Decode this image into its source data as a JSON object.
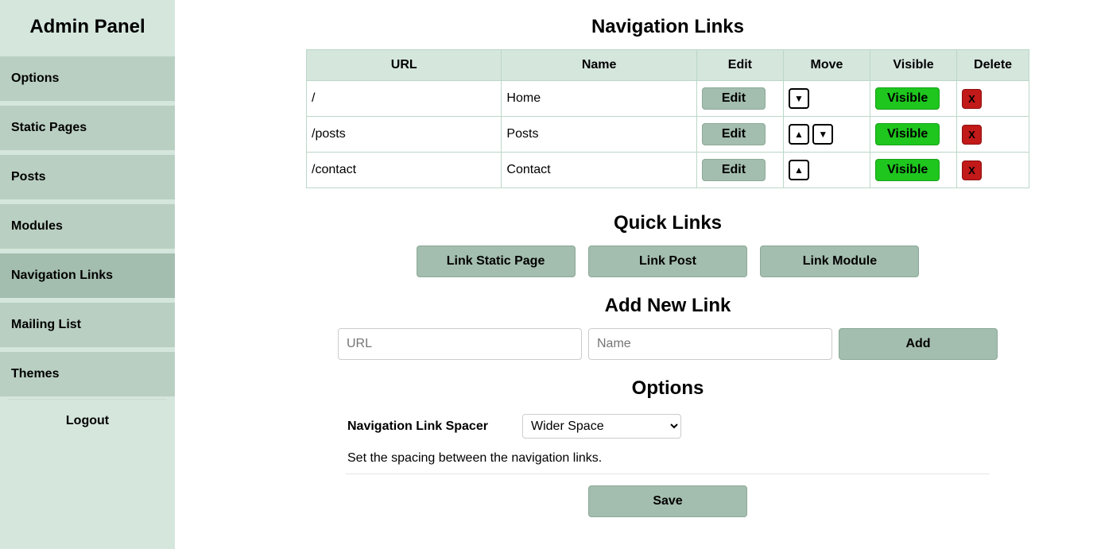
{
  "sidebar": {
    "title": "Admin Panel",
    "items": [
      {
        "label": "Options"
      },
      {
        "label": "Static Pages"
      },
      {
        "label": "Posts"
      },
      {
        "label": "Modules"
      },
      {
        "label": "Navigation Links",
        "active": true
      },
      {
        "label": "Mailing List"
      },
      {
        "label": "Themes"
      }
    ],
    "logout_label": "Logout"
  },
  "nav_section": {
    "title": "Navigation Links",
    "headers": {
      "url": "URL",
      "name": "Name",
      "edit": "Edit",
      "move": "Move",
      "visible": "Visible",
      "delete": "Delete"
    },
    "edit_label": "Edit",
    "visible_label": "Visible",
    "delete_label": "X",
    "up_icon": "▲",
    "down_icon": "▼",
    "rows": [
      {
        "url": "/",
        "name": "Home",
        "up": false,
        "down": true
      },
      {
        "url": "/posts",
        "name": "Posts",
        "up": true,
        "down": true
      },
      {
        "url": "/contact",
        "name": "Contact",
        "up": true,
        "down": false
      }
    ]
  },
  "quick": {
    "title": "Quick Links",
    "static_label": "Link Static Page",
    "post_label": "Link Post",
    "module_label": "Link Module"
  },
  "add": {
    "title": "Add New Link",
    "url_placeholder": "URL",
    "name_placeholder": "Name",
    "add_label": "Add"
  },
  "options": {
    "title": "Options",
    "spacer_label": "Navigation Link Spacer",
    "spacer_value": "Wider Space",
    "spacer_help": "Set the spacing between the navigation links.",
    "save_label": "Save"
  }
}
